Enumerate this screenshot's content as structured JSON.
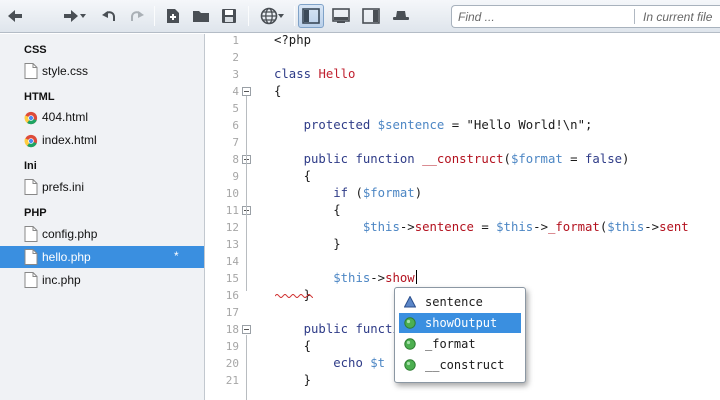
{
  "toolbar": {
    "buttons": [
      {
        "id": "back",
        "icon": "back-arrow-icon"
      },
      {
        "id": "forward",
        "icon": "forward-arrow-icon"
      },
      {
        "id": "undo",
        "icon": "undo-icon"
      },
      {
        "id": "redo",
        "icon": "redo-icon"
      },
      {
        "id": "new-file",
        "icon": "new-file-icon"
      },
      {
        "id": "open-folder",
        "icon": "folder-icon"
      },
      {
        "id": "save",
        "icon": "save-icon"
      },
      {
        "id": "browser",
        "icon": "globe-icon"
      },
      {
        "id": "layout-sidebar",
        "icon": "sidebar-layout-icon",
        "active": true
      },
      {
        "id": "layout-bottom",
        "icon": "bottom-panel-icon"
      },
      {
        "id": "layout-right",
        "icon": "right-panel-icon"
      },
      {
        "id": "layout-hat",
        "icon": "hat-icon"
      }
    ],
    "search": {
      "placeholder": "Find ...",
      "scope": "In current file"
    }
  },
  "sidebar": {
    "groups": [
      {
        "label": "CSS",
        "files": [
          {
            "name": "style.css",
            "icon": "document-icon"
          }
        ]
      },
      {
        "label": "HTML",
        "files": [
          {
            "name": "404.html",
            "icon": "chrome-icon"
          },
          {
            "name": "index.html",
            "icon": "chrome-icon"
          }
        ]
      },
      {
        "label": "Ini",
        "files": [
          {
            "name": "prefs.ini",
            "icon": "document-icon"
          }
        ]
      },
      {
        "label": "PHP",
        "files": [
          {
            "name": "config.php",
            "icon": "document-icon"
          },
          {
            "name": "hello.php",
            "icon": "document-icon",
            "selected": true,
            "modified": "*"
          },
          {
            "name": "inc.php",
            "icon": "document-icon"
          }
        ]
      }
    ]
  },
  "editor": {
    "line_numbers": [
      "1",
      "2",
      "3",
      "4",
      "5",
      "6",
      "7",
      "8",
      "9",
      "10",
      "11",
      "12",
      "13",
      "14",
      "15",
      "16",
      "17",
      "18",
      "19",
      "20",
      "21"
    ],
    "lines": [
      "<?php",
      "",
      "class Hello",
      "{",
      "",
      "    protected $sentence = \"Hello World!\\n\";",
      "",
      "    public function __construct($format = false)",
      "    {",
      "        if ($format)",
      "        {",
      "            $this->sentence = $this->_format($this->sent",
      "        }",
      "",
      "        $this->show",
      "    }",
      "",
      "    public function",
      "    {",
      "        echo $t",
      "    }"
    ],
    "autocomplete": {
      "items": [
        {
          "label": "sentence",
          "icon": "property-icon"
        },
        {
          "label": "showOutput",
          "icon": "method-icon",
          "selected": true
        },
        {
          "label": "_format",
          "icon": "method-icon"
        },
        {
          "label": "__construct",
          "icon": "method-icon"
        }
      ]
    }
  },
  "colors": {
    "accent": "#3a8fe0",
    "keyword": "#2f3c88",
    "classname": "#c0202f",
    "variable": "#4c86c4"
  }
}
